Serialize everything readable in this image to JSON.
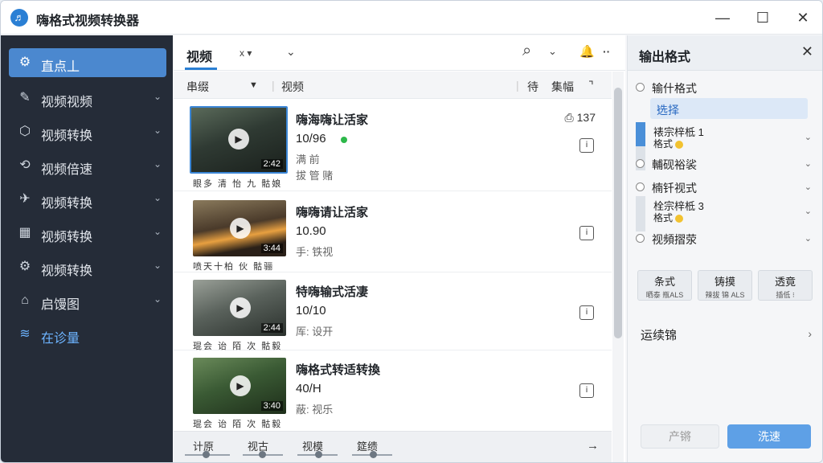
{
  "app": {
    "title": "嗨格式视频转换器",
    "logo": "♬"
  },
  "window_controls": {
    "minimize": "—",
    "maximize": "☐",
    "close": "✕"
  },
  "sidebar": {
    "items": [
      {
        "label": "直点丄",
        "icon": "gear-icon",
        "glyph": "⚙",
        "chevron": ""
      },
      {
        "label": "视频视频",
        "icon": "wrench-icon",
        "glyph": "✎",
        "chevron": "⌄"
      },
      {
        "label": "视频转换",
        "icon": "shield-icon",
        "glyph": "⬡",
        "chevron": "⌄"
      },
      {
        "label": "视频倍速",
        "icon": "link-icon",
        "glyph": "⟲",
        "chevron": "⌄"
      },
      {
        "label": "视频转换",
        "icon": "rocket-icon",
        "glyph": "✈",
        "chevron": "⌄"
      },
      {
        "label": "视频转换",
        "icon": "calendar-icon",
        "glyph": "▦",
        "chevron": "⌄"
      },
      {
        "label": "视频转换",
        "icon": "settings-icon",
        "glyph": "⚙",
        "chevron": "⌄"
      },
      {
        "label": "启馒图",
        "icon": "home-icon",
        "glyph": "⌂",
        "chevron": "⌄"
      },
      {
        "label": "在诊量",
        "icon": "wifi-icon",
        "glyph": "≋",
        "chevron": ""
      }
    ]
  },
  "main": {
    "tab": "视频",
    "toolbar": {
      "filter": "x ▾",
      "dropdown": "⌄",
      "search": "⌕",
      "search_drop": "⌄",
      "bell": "🔔",
      "more": "··"
    },
    "columns": {
      "name": "串缀",
      "sort": "▼",
      "preview": "视频",
      "duration": "待",
      "size": "集幅",
      "extra": "⌝"
    },
    "rows": [
      {
        "title": "嗨海嗨让活家",
        "res": "10/96",
        "meta1": "满 前",
        "meta2": "拔 管 赌",
        "caption": "眼多 清 怡 九 骷娘",
        "duration": "2:42",
        "size": "137",
        "size_icon": "⎙",
        "status_dot": true
      },
      {
        "title": "嗨嗨请让活家",
        "res": "10.90",
        "meta1": "手: 铁视",
        "meta2": "",
        "caption": "喷天十柏 伙 骷骊",
        "duration": "3:44",
        "size": "",
        "size_icon": "",
        "status_dot": false
      },
      {
        "title": "特嗨输式活凄",
        "res": "10/10",
        "meta1": "厍: 设开",
        "meta2": "",
        "caption": "琨会 诒 陌 次 骷毅",
        "duration": "2:44",
        "size": "",
        "size_icon": "",
        "status_dot": false
      },
      {
        "title": "嗨格式转适转換",
        "res": "40/H",
        "meta1": "蔽: 视乐",
        "meta2": "",
        "caption": "琨会 诒 陌 次 骷毅",
        "duration": "3:40",
        "size": "",
        "size_icon": "",
        "status_dot": false
      }
    ],
    "bottom": {
      "items": [
        "计原",
        "视古",
        "视模",
        "筵缋"
      ],
      "arrow": "→"
    }
  },
  "right_panel": {
    "title": "输出格式",
    "close": "✕",
    "options": [
      {
        "label": "输什格式",
        "type": "radio"
      },
      {
        "label": "选择",
        "type": "select"
      },
      {
        "label": "裱宗梓柢 1",
        "sub": "格式",
        "type": "bar"
      },
      {
        "label": "輔砚裕裟",
        "type": "radio"
      },
      {
        "label": "楠钎视式",
        "type": "radio"
      },
      {
        "label": "栓宗梓柢 3",
        "sub": "格式",
        "type": "bar"
      },
      {
        "label": "视頻摺荥",
        "type": "radio"
      }
    ],
    "presets": [
      {
        "label": "条式",
        "sub": "晒泰 瓶ALS"
      },
      {
        "label": "铸摸",
        "sub": "辣拔 锦 ALS"
      },
      {
        "label": "透竟",
        "sub": "插低 ⁝"
      }
    ],
    "advanced": "运续锦",
    "reset_button": "产锵",
    "convert_button": "洗速"
  }
}
